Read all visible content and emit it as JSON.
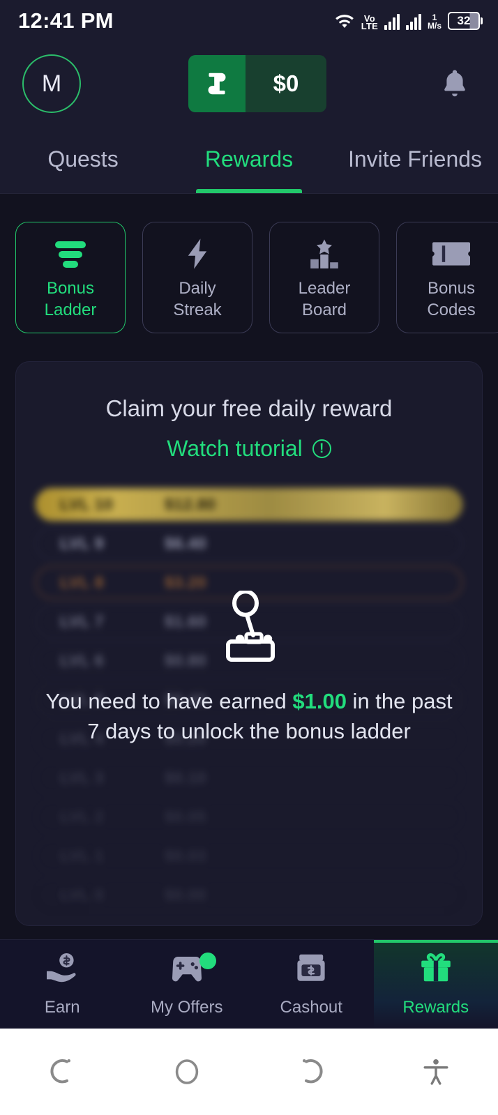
{
  "status_bar": {
    "time": "12:41 PM",
    "volte_top": "Vo",
    "volte_bottom": "LTE",
    "net_speed_value": "1",
    "net_speed_unit": "M/s",
    "battery_level": "32",
    "icons": [
      "wifi-icon",
      "volte-icon",
      "signal-bars-sim1-icon",
      "signal-bars-sim2-icon",
      "battery-icon"
    ]
  },
  "header": {
    "avatar_initial": "M",
    "balance_amount": "$0",
    "balance_logo_icon": "app-logo-icon",
    "notification_icon": "bell-icon"
  },
  "top_tabs": [
    {
      "label": "Quests",
      "active": false
    },
    {
      "label": "Rewards",
      "active": true
    },
    {
      "label": "Invite Friends",
      "active": false
    }
  ],
  "chips": [
    {
      "label_line1": "Bonus",
      "label_line2": "Ladder",
      "icon": "ladder-bars-icon",
      "active": true
    },
    {
      "label_line1": "Daily",
      "label_line2": "Streak",
      "icon": "lightning-bolt-icon",
      "active": false
    },
    {
      "label_line1": "Leader",
      "label_line2": "Board",
      "icon": "podium-star-icon",
      "active": false
    },
    {
      "label_line1": "Bonus",
      "label_line2": "Codes",
      "icon": "ticket-icon",
      "active": false
    }
  ],
  "card": {
    "title": "Claim your free daily reward",
    "tutorial_link": "Watch tutorial",
    "tutorial_icon": "info-circle-icon",
    "lock_icon": "joystick-icon",
    "lock_message_part1": "You need to have earned ",
    "lock_message_highlight": "$1.00",
    "lock_message_part2": " in the past 7 days to unlock the bonus ladder"
  },
  "ladder": {
    "rows": [
      {
        "level": "LVL 10",
        "amount": "$12.80",
        "style": "gold"
      },
      {
        "level": "LVL 9",
        "amount": "$6.40",
        "style": "silver"
      },
      {
        "level": "LVL 8",
        "amount": "$3.20",
        "style": "bronze"
      },
      {
        "level": "LVL 7",
        "amount": "$1.60",
        "style": "dim1"
      },
      {
        "level": "LVL 6",
        "amount": "$0.80",
        "style": "dim2"
      },
      {
        "level": "LVL 5",
        "amount": "$0.40",
        "style": "dim3"
      },
      {
        "level": "LVL 4",
        "amount": "$0.20",
        "style": "dim4"
      },
      {
        "level": "LVL 3",
        "amount": "$0.10",
        "style": "dim5"
      },
      {
        "level": "LVL 2",
        "amount": "$0.05",
        "style": "dim6"
      },
      {
        "level": "LVL 1",
        "amount": "$0.03",
        "style": "dim6"
      },
      {
        "level": "LVL 0",
        "amount": "$0.00",
        "style": "dim6"
      }
    ]
  },
  "bottom_nav": [
    {
      "label": "Earn",
      "icon": "hand-coin-icon",
      "active": false,
      "badge": false
    },
    {
      "label": "My Offers",
      "icon": "gamepad-icon",
      "active": false,
      "badge": true
    },
    {
      "label": "Cashout",
      "icon": "atm-cash-icon",
      "active": false,
      "badge": false
    },
    {
      "label": "Rewards",
      "icon": "gift-box-icon",
      "active": true,
      "badge": false
    }
  ],
  "android_nav": [
    {
      "icon": "back-icon"
    },
    {
      "icon": "home-circle-icon"
    },
    {
      "icon": "recents-icon"
    },
    {
      "icon": "accessibility-icon"
    }
  ],
  "colors": {
    "accent_green": "#22dd7d",
    "accent_green_dark": "#0f7a41",
    "background": "#12121f",
    "surface": "#1b1b2e",
    "card": "#1a1a2c",
    "muted_text": "#a9abc2",
    "gold": "#d8bc52",
    "bronze": "#a4622c"
  }
}
